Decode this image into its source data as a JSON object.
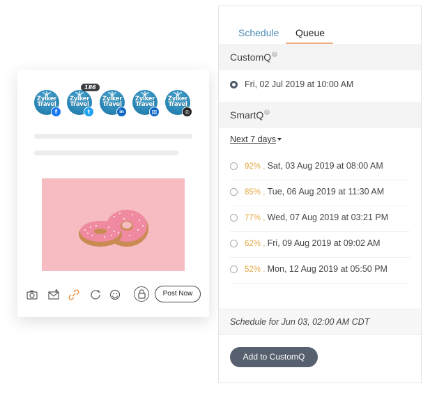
{
  "composer": {
    "profiles": [
      {
        "brand_line1": "Zylker",
        "brand_line2": "Travel",
        "network": "facebook",
        "network_icon": "facebook-icon",
        "color": "#1877f2"
      },
      {
        "brand_line1": "Zylker",
        "brand_line2": "Travel",
        "network": "twitter",
        "network_icon": "twitter-icon",
        "color": "#1da1f2",
        "count": "186"
      },
      {
        "brand_line1": "Zylker",
        "brand_line2": "Travel",
        "network": "linkedin",
        "network_icon": "linkedin-icon",
        "color": "#0a66c2"
      },
      {
        "brand_line1": "Zylker",
        "brand_line2": "Travel",
        "network": "linkedin-page",
        "network_icon": "linkedin-page-icon",
        "color": "#0a66c2"
      },
      {
        "brand_line1": "Zylker",
        "brand_line2": "Travel",
        "network": "instagram",
        "network_icon": "instagram-icon",
        "color": "#222222"
      }
    ],
    "toolbar": {
      "icons": [
        "camera-icon",
        "mail-icon",
        "link-icon",
        "refresh-icon",
        "emoji-icon",
        "lock-icon"
      ],
      "post_now_label": "Post Now"
    },
    "image_bg_color": "#f6bcc1"
  },
  "panel": {
    "tabs": [
      {
        "label": "Schedule",
        "active": false
      },
      {
        "label": "Queue",
        "active": true
      }
    ],
    "custom_q": {
      "title": "CustomQ",
      "selected_slot": "Fri, 02 Jul 2019 at 10:00 AM"
    },
    "smart_q": {
      "title": "SmartQ",
      "range_label": "Next 7 days",
      "slots": [
        {
          "percent": "92%",
          "text": "Sat, 03 Aug 2019 at 08:00 AM"
        },
        {
          "percent": "85%",
          "text": "Tue, 06 Aug 2019 at 11:30 AM"
        },
        {
          "percent": "77%",
          "text": "Wed, 07 Aug 2019 at 03:21 PM"
        },
        {
          "percent": "62%",
          "text": "Fri, 09 Aug 2019 at 09:02 AM"
        },
        {
          "percent": "52%",
          "text": "Mon, 12 Aug 2019 at 05:50 PM"
        }
      ]
    },
    "schedule_for": "Schedule for Jun 03, 02:00 AM  CDT",
    "add_button": "Add to CustomQ",
    "accent_color": "#f0b080",
    "percent_color": "#e2a743"
  }
}
